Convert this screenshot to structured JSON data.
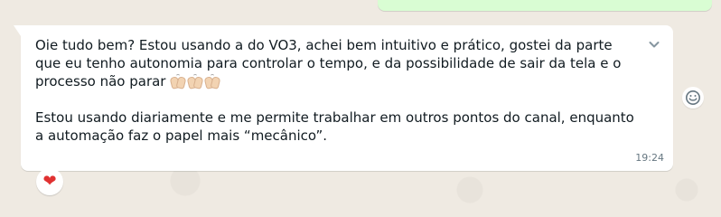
{
  "message": {
    "paragraph_1_text": "Oie tudo bem? Estou usando a do VO3, achei bem intuitivo e prático, gostei da parte\nque eu tenho autonomia para controlar o tempo, e da possibilidade de sair da tela e o\nprocesso não parar ",
    "paragraph_2_text": "Estou usando diariamente e me permite trabalhar em outros pontos do canal, enquanto\na automação faz o papel mais “mecânico”.",
    "timestamp": "19:24",
    "inline_emojis": [
      "raised-hands-icon",
      "raised-hands-icon",
      "raised-hands-icon"
    ]
  },
  "reactions": {
    "heart": "❤"
  },
  "icons": {
    "menu": "chevron-down-icon",
    "react": "smile-icon"
  },
  "colors": {
    "chat_background": "#efeae2",
    "incoming_bubble": "#ffffff",
    "outgoing_bubble": "#d9fdd3",
    "text": "#111b21",
    "secondary_text": "#667781",
    "heart": "#e03131"
  }
}
